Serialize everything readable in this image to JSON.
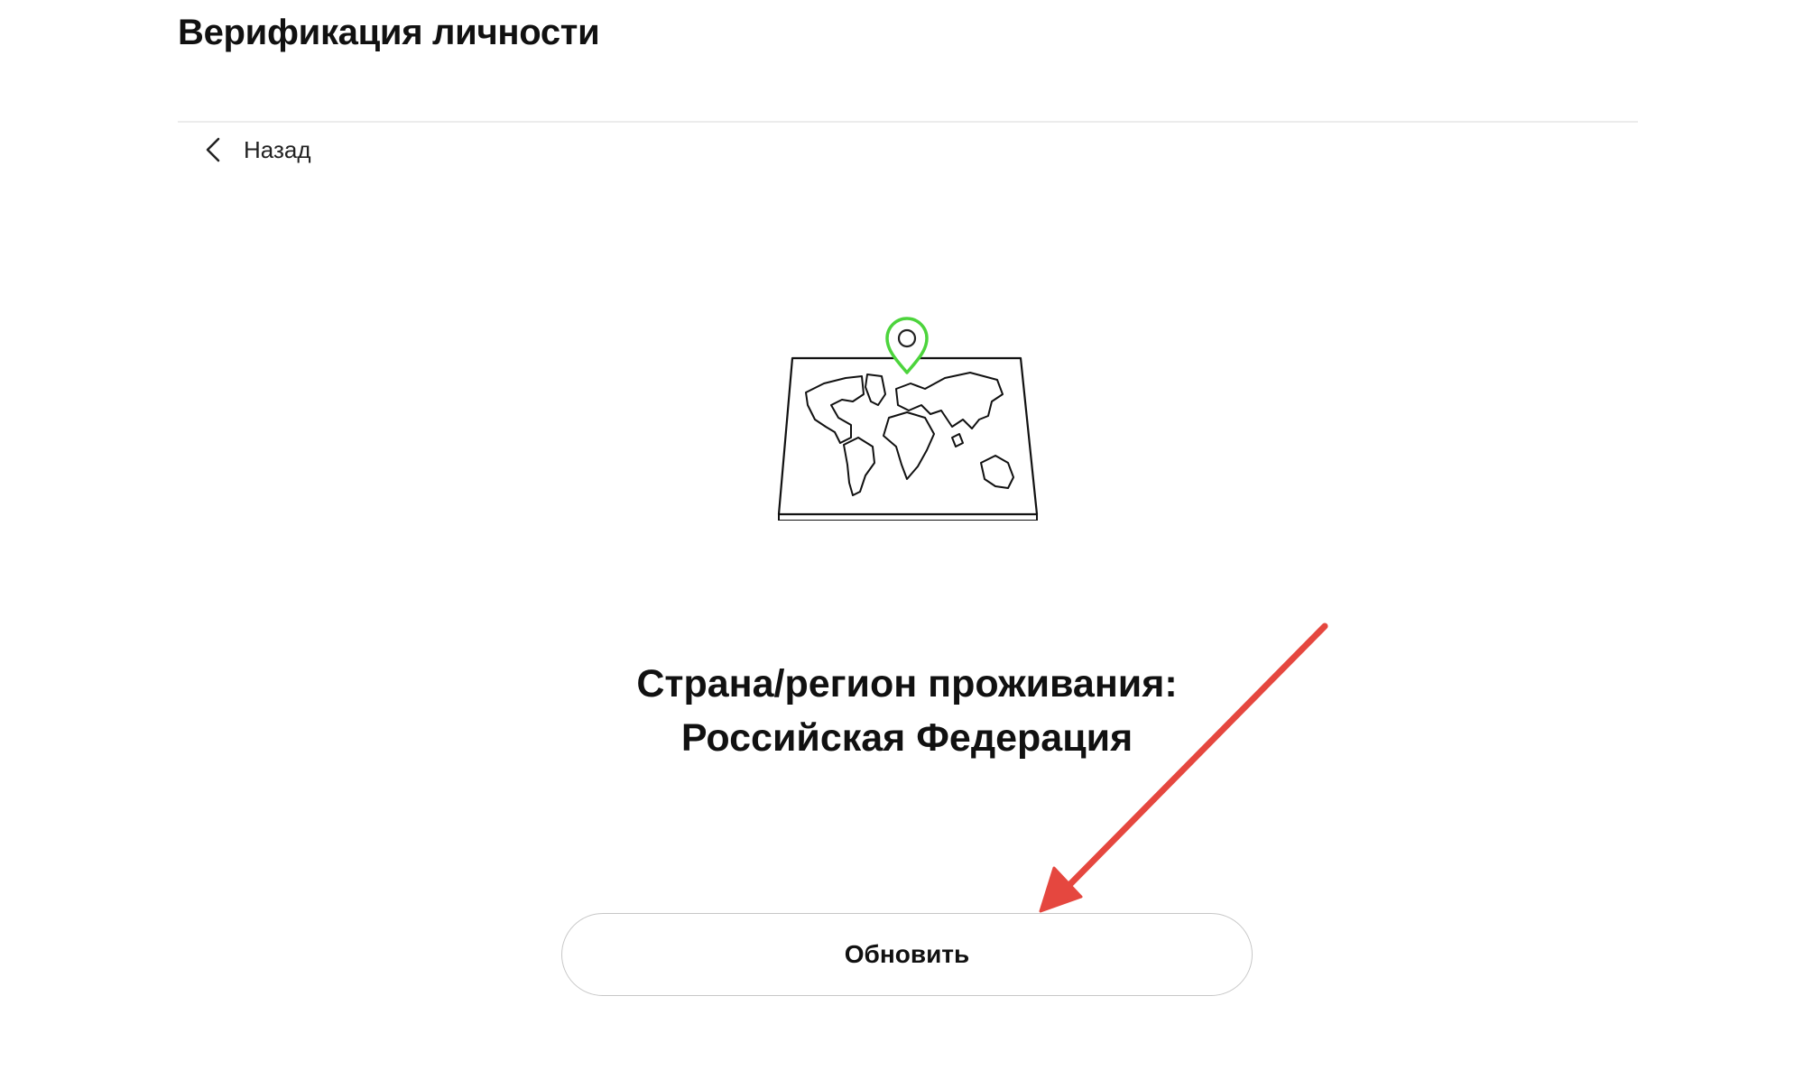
{
  "header": {
    "title": "Верификация личности"
  },
  "nav": {
    "back_label": "Назад",
    "back_icon": "chevron-left-icon"
  },
  "illustration": {
    "icon": "world-map-location-icon",
    "pin_color": "#4cd43c"
  },
  "residence": {
    "label_line": "Страна/регион проживания:",
    "country": "Российская Федерация"
  },
  "actions": {
    "update_label": "Обновить"
  },
  "annotation": {
    "icon": "red-arrow-icon",
    "color": "#e5473f"
  }
}
